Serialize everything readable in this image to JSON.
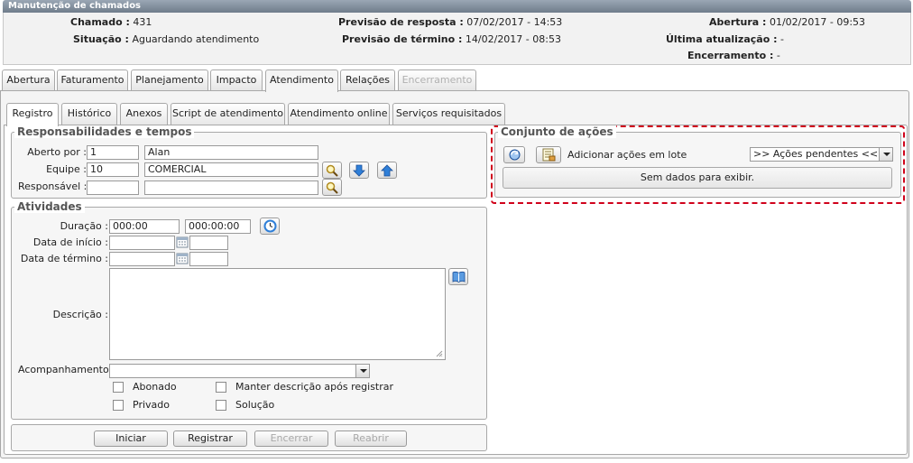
{
  "window": {
    "title": "Manutenção de chamados"
  },
  "header": {
    "chamado_label": "Chamado :",
    "chamado_value": "431",
    "situacao_label": "Situação :",
    "situacao_value": "Aguardando atendimento",
    "previsao_resposta_label": "Previsão de resposta :",
    "previsao_resposta_value": "07/02/2017 - 14:53",
    "previsao_termino_label": "Previsão de término :",
    "previsao_termino_value": "14/02/2017 - 08:53",
    "abertura_label": "Abertura :",
    "abertura_value": "01/02/2017 - 09:53",
    "ultima_atualizacao_label": "Última atualização :",
    "ultima_atualizacao_value": "-",
    "encerramento_label": "Encerramento :",
    "encerramento_value": "-"
  },
  "main_tabs": [
    {
      "label": "Abertura"
    },
    {
      "label": "Faturamento"
    },
    {
      "label": "Planejamento"
    },
    {
      "label": "Impacto"
    },
    {
      "label": "Atendimento"
    },
    {
      "label": "Relações"
    },
    {
      "label": "Encerramento"
    }
  ],
  "sub_tabs": [
    {
      "label": "Registro"
    },
    {
      "label": "Histórico"
    },
    {
      "label": "Anexos"
    },
    {
      "label": "Script de atendimento"
    },
    {
      "label": "Atendimento online"
    },
    {
      "label": "Serviços requisitados"
    }
  ],
  "responsabilidades": {
    "title": "Responsabilidades e tempos",
    "aberto_por_label": "Aberto por :",
    "aberto_por_code": "1",
    "aberto_por_name": "Alan",
    "equipe_label": "Equipe :",
    "equipe_code": "10",
    "equipe_name": "COMERCIAL",
    "responsavel_label": "Responsável :",
    "responsavel_code": "",
    "responsavel_name": ""
  },
  "atividades": {
    "title": "Atividades",
    "duracao_label": "Duração :",
    "duracao_value1": "000:00",
    "duracao_value2": "000:00:00",
    "data_inicio_label": "Data de início :",
    "data_termino_label": "Data de término :",
    "descricao_label": "Descrição :",
    "acompanhamento_label": "Acompanhamento :",
    "acompanhamento_value": "",
    "abonado_label": "Abonado",
    "manter_descricao_label": "Manter descrição após registrar",
    "privado_label": "Privado",
    "solucao_label": "Solução"
  },
  "buttons": {
    "iniciar": "Iniciar",
    "registrar": "Registrar",
    "encerrar": "Encerrar",
    "reabrir": "Reabrir"
  },
  "conjunto_acoes": {
    "title": "Conjunto de ações",
    "adicionar_label": "Adicionar ações em lote",
    "select_value": ">> Ações pendentes <<",
    "empty_message": "Sem dados para exibir."
  },
  "colors": {
    "titlebar": "#7d8998",
    "highlight_border": "#d0021b"
  }
}
